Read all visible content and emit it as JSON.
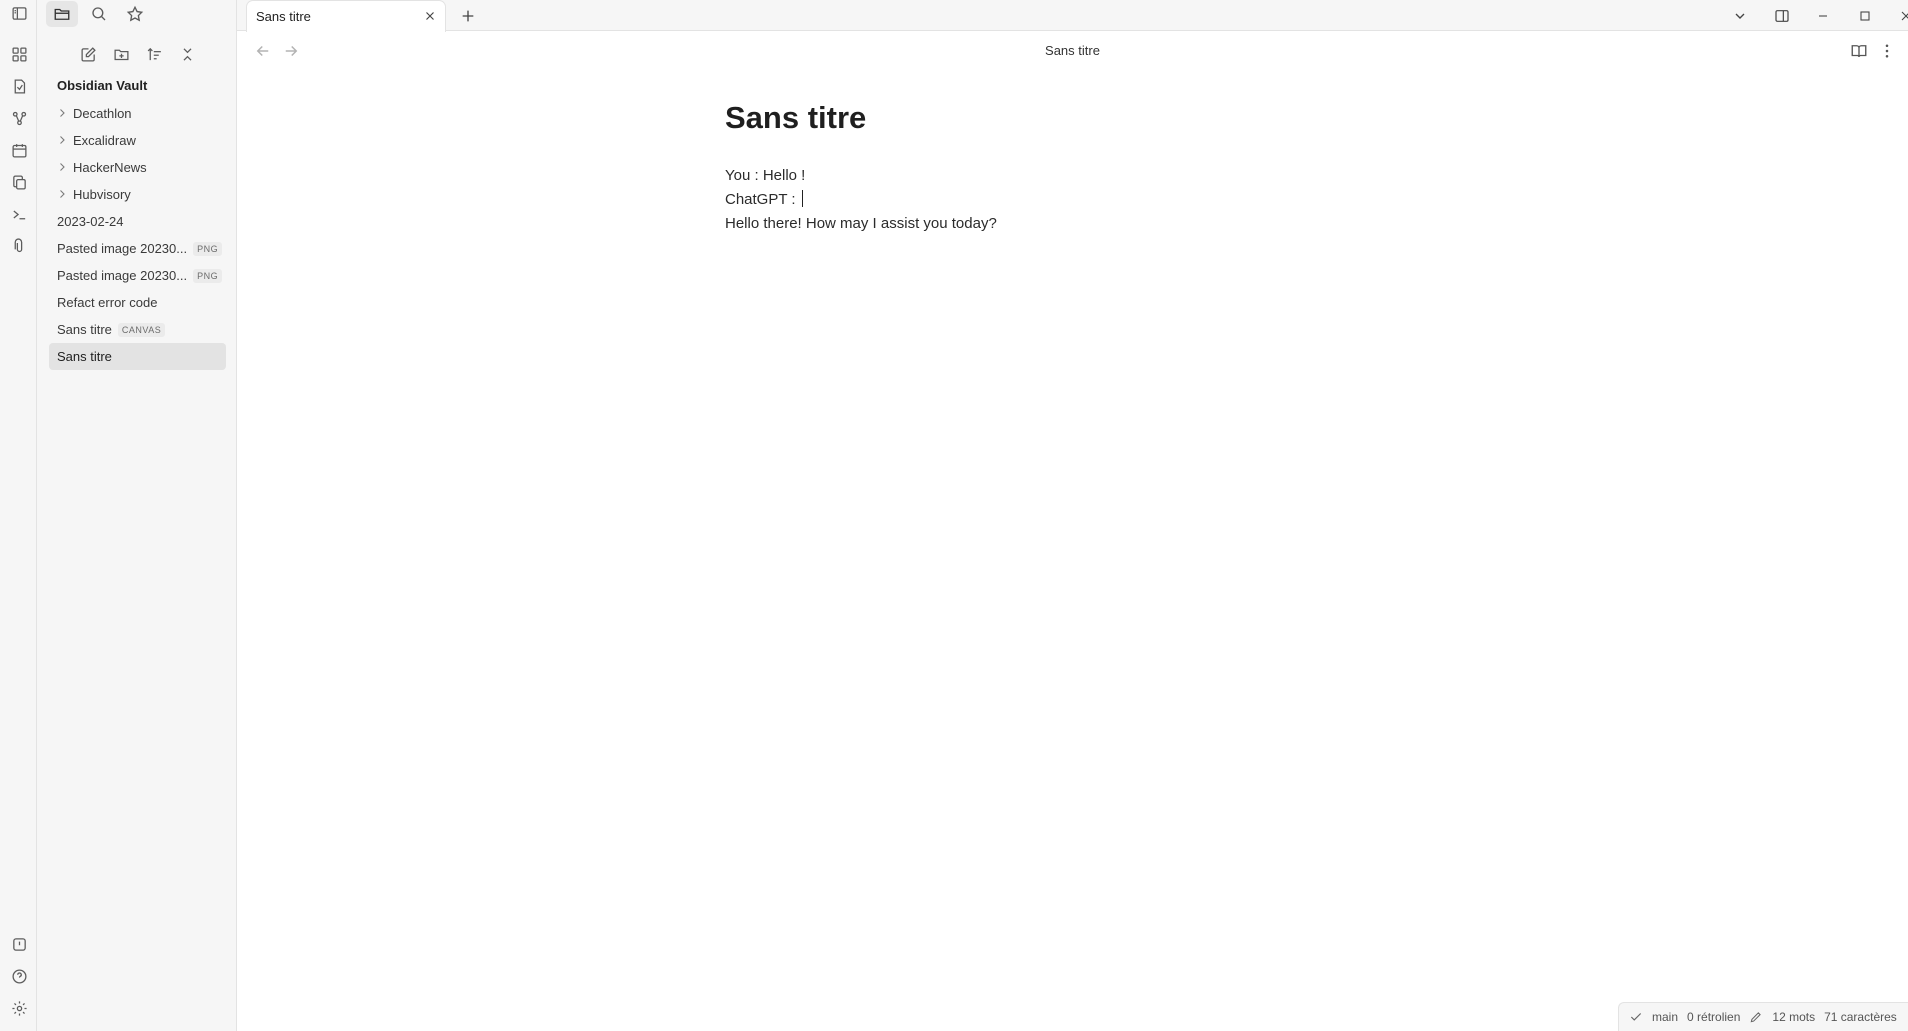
{
  "window": {
    "controls": [
      "minimize",
      "maximize",
      "close"
    ]
  },
  "tab": {
    "title": "Sans titre"
  },
  "view": {
    "title": "Sans titre"
  },
  "sidebar": {
    "vault_name": "Obsidian Vault",
    "items": [
      {
        "label": "Decathlon",
        "type": "folder"
      },
      {
        "label": "Excalidraw",
        "type": "folder"
      },
      {
        "label": "HackerNews",
        "type": "folder"
      },
      {
        "label": "Hubvisory",
        "type": "folder"
      },
      {
        "label": "2023-02-24",
        "type": "file"
      },
      {
        "label": "Pasted image 20230...",
        "type": "file",
        "badge": "PNG"
      },
      {
        "label": "Pasted image 20230...",
        "type": "file",
        "badge": "PNG"
      },
      {
        "label": "Refact error code",
        "type": "file"
      },
      {
        "label": "Sans titre",
        "type": "file",
        "badge": "CANVAS"
      },
      {
        "label": "Sans titre",
        "type": "file",
        "active": true
      }
    ]
  },
  "document": {
    "title": "Sans titre",
    "lines": [
      "You :  Hello !",
      "ChatGPT :",
      "Hello there! How may I assist you today?"
    ]
  },
  "status": {
    "branch": "main",
    "backlinks": "0 rétrolien",
    "words": "12 mots",
    "chars": "71 caractères"
  },
  "icons": {
    "ribbon_top": [
      "dashboard-icon",
      "note-icon",
      "graph-icon",
      "calendar-icon",
      "copy-icon",
      "terminal-icon",
      "paperclip-icon"
    ],
    "ribbon_bottom": [
      "vault-switch-icon",
      "help-icon",
      "settings-icon"
    ]
  }
}
